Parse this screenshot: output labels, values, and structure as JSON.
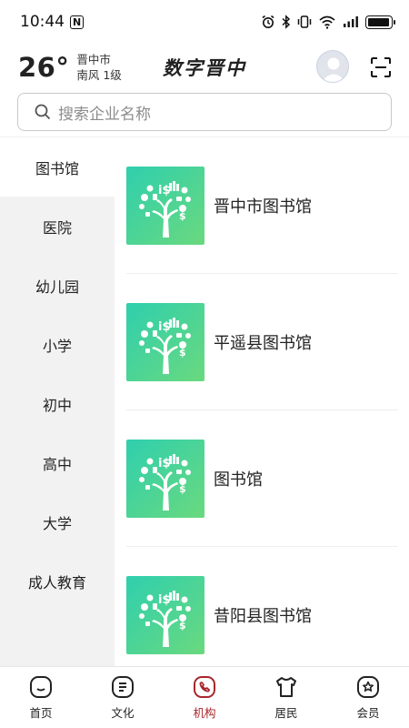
{
  "status_bar": {
    "time": "10:44",
    "nfc": "N",
    "battery_level": 0.95
  },
  "weather": {
    "temperature": "26°",
    "city": "晋中市",
    "wind": "南风 1级"
  },
  "header": {
    "title": "数字晋中",
    "avatar_icon": "avatar-icon",
    "scan_icon": "scan-icon"
  },
  "search": {
    "placeholder": "搜索企业名称"
  },
  "categories": [
    {
      "label": "图书馆",
      "active": true
    },
    {
      "label": "医院"
    },
    {
      "label": "幼儿园"
    },
    {
      "label": "小学"
    },
    {
      "label": "初中"
    },
    {
      "label": "高中"
    },
    {
      "label": "大学"
    },
    {
      "label": "成人教育"
    }
  ],
  "institutions": [
    {
      "name": "晋中市图书馆"
    },
    {
      "name": "平遥县图书馆"
    },
    {
      "name": "图书馆"
    },
    {
      "name": "昔阳县图书馆"
    }
  ],
  "tabs": [
    {
      "label": "首页",
      "icon": "home-icon"
    },
    {
      "label": "文化",
      "icon": "culture-icon"
    },
    {
      "label": "机构",
      "icon": "institution-icon",
      "active": true
    },
    {
      "label": "居民",
      "icon": "resident-icon"
    },
    {
      "label": "会员",
      "icon": "member-icon"
    }
  ],
  "colors": {
    "accent": "#a8262b",
    "thumb_from": "#35d0a6",
    "thumb_to": "#62d983",
    "sidebar_bg": "#f2f2f2"
  }
}
